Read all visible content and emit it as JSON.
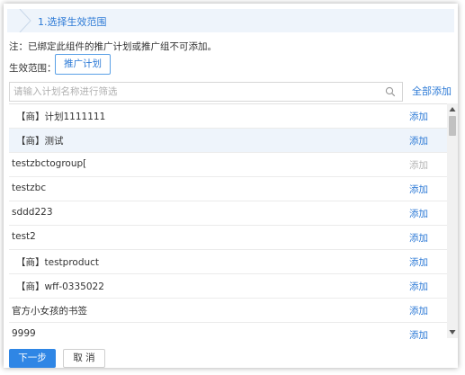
{
  "step": {
    "title": "1.选择生效范围"
  },
  "notice": "注：已绑定此组件的推广计划或推广组不可添加。",
  "scope": {
    "label": "生效范围：",
    "button": "推广计划"
  },
  "search": {
    "placeholder": "请输入计划名称进行筛选"
  },
  "add_all": "全部添加",
  "rows": [
    {
      "label": "【商】计划1111111",
      "action": "添加",
      "enabled": true,
      "selected": false
    },
    {
      "label": "【商】测试",
      "action": "添加",
      "enabled": true,
      "selected": true
    },
    {
      "label": "testzbctogroup[",
      "action": "添加",
      "enabled": false,
      "selected": false
    },
    {
      "label": "testzbc",
      "action": "添加",
      "enabled": true,
      "selected": false
    },
    {
      "label": "sddd223",
      "action": "添加",
      "enabled": true,
      "selected": false
    },
    {
      "label": "test2",
      "action": "添加",
      "enabled": true,
      "selected": false
    },
    {
      "label": "【商】testproduct",
      "action": "添加",
      "enabled": true,
      "selected": false
    },
    {
      "label": "【商】wff-0335022",
      "action": "添加",
      "enabled": true,
      "selected": false
    },
    {
      "label": "官方小女孩的书签",
      "action": "添加",
      "enabled": true,
      "selected": false
    },
    {
      "label": "9999",
      "action": "添加",
      "enabled": true,
      "selected": false
    }
  ],
  "footer": {
    "next": "下一步",
    "cancel": "取 消"
  },
  "colors": {
    "accent": "#2d7ad6",
    "primary_button": "#2f86e5",
    "header_bg": "#eef4fb",
    "disabled": "#b5b5b5"
  },
  "icons": {
    "search": "search-icon",
    "step": "chevron-right-icon"
  }
}
